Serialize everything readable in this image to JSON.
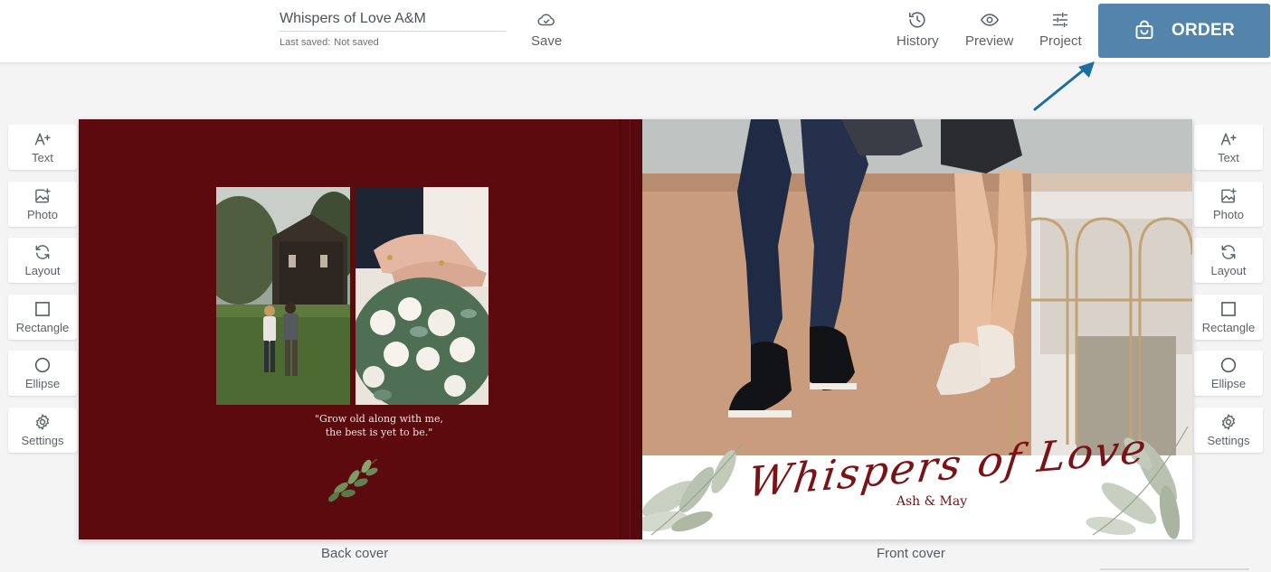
{
  "header": {
    "project_title": "Whispers of Love A&M",
    "last_saved_label": "Last saved:",
    "last_saved_value": "Not saved",
    "save_label": "Save",
    "history_label": "History",
    "preview_label": "Preview",
    "project_label": "Project",
    "order_label": "ORDER"
  },
  "left_tools": [
    {
      "label": "Text",
      "icon": "text-add-icon"
    },
    {
      "label": "Photo",
      "icon": "photo-add-icon"
    },
    {
      "label": "Layout",
      "icon": "layout-refresh-icon"
    },
    {
      "label": "Rectangle",
      "icon": "rectangle-icon"
    },
    {
      "label": "Ellipse",
      "icon": "ellipse-icon"
    },
    {
      "label": "Settings",
      "icon": "gear-icon"
    }
  ],
  "right_tools": [
    {
      "label": "Text",
      "icon": "text-add-icon"
    },
    {
      "label": "Photo",
      "icon": "photo-add-icon"
    },
    {
      "label": "Layout",
      "icon": "layout-refresh-icon"
    },
    {
      "label": "Rectangle",
      "icon": "rectangle-icon"
    },
    {
      "label": "Ellipse",
      "icon": "ellipse-icon"
    },
    {
      "label": "Settings",
      "icon": "gear-icon"
    }
  ],
  "back_cover": {
    "quote_line1": "\"Grow old along with me,",
    "quote_line2": "the best is yet to be.\"",
    "caption": "Back cover",
    "background_color": "#5c0a0e"
  },
  "front_cover": {
    "title": "Whispers of Love",
    "subtitle": "Ash & May",
    "caption": "Front cover"
  },
  "colors": {
    "accent": "#5385ac",
    "arrow": "#1a6fa0",
    "cover_text": "#7a1216"
  }
}
